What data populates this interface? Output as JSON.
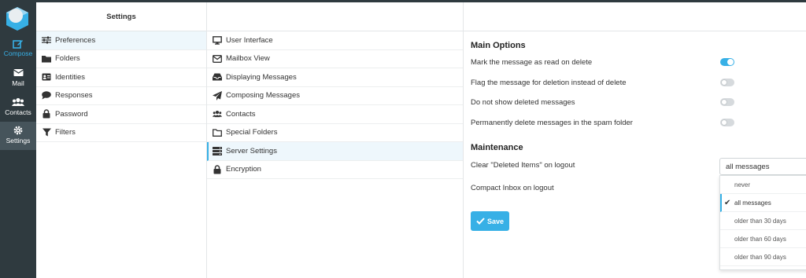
{
  "nav": {
    "items": [
      {
        "label": "Compose",
        "icon": "compose-icon"
      },
      {
        "label": "Mail",
        "icon": "mail-icon"
      },
      {
        "label": "Contacts",
        "icon": "contacts-icon"
      },
      {
        "label": "Settings",
        "icon": "gear-icon"
      }
    ],
    "accent": "#37b0e6"
  },
  "settings": {
    "header": "Settings",
    "items": [
      {
        "label": "Preferences",
        "icon": "sliders-icon"
      },
      {
        "label": "Folders",
        "icon": "folder-icon"
      },
      {
        "label": "Identities",
        "icon": "id-card-icon"
      },
      {
        "label": "Responses",
        "icon": "comment-icon"
      },
      {
        "label": "Password",
        "icon": "lock-icon"
      },
      {
        "label": "Filters",
        "icon": "filter-icon"
      }
    ]
  },
  "sections": {
    "items": [
      {
        "label": "User Interface",
        "icon": "monitor-icon"
      },
      {
        "label": "Mailbox View",
        "icon": "envelope-icon"
      },
      {
        "label": "Displaying Messages",
        "icon": "inbox-icon"
      },
      {
        "label": "Composing Messages",
        "icon": "paper-plane-icon"
      },
      {
        "label": "Contacts",
        "icon": "users-icon"
      },
      {
        "label": "Special Folders",
        "icon": "folder-outline-icon"
      },
      {
        "label": "Server Settings",
        "icon": "server-icon"
      },
      {
        "label": "Encryption",
        "icon": "lock-icon"
      }
    ]
  },
  "main": {
    "main_options_title": "Main Options",
    "options": [
      {
        "label": "Mark the message as read on delete",
        "enabled": true
      },
      {
        "label": "Flag the message for deletion instead of delete",
        "enabled": false
      },
      {
        "label": "Do not show deleted messages",
        "enabled": false
      },
      {
        "label": "Permanently delete messages in the spam folder",
        "enabled": false
      }
    ],
    "maintenance_title": "Maintenance",
    "clear_deleted_label": "Clear \"Deleted Items\" on logout",
    "clear_deleted_value": "all messages",
    "compact_inbox_label": "Compact Inbox on logout",
    "dropdown_options": [
      "never",
      "all messages",
      "older than 30 days",
      "older than 60 days",
      "older than 90 days"
    ],
    "save_label": "Save"
  }
}
